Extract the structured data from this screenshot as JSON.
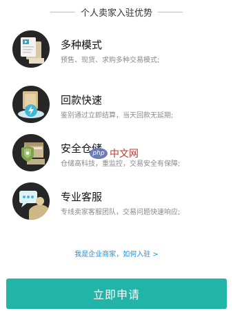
{
  "header": {
    "title": "个人卖家入驻优势"
  },
  "features": [
    {
      "title": "多种模式",
      "desc": "预售、现货、求购多种交易模式;",
      "icon": "documents-icon"
    },
    {
      "title": "回款快速",
      "desc": "鉴别通过立即结算，当天回款无延期;",
      "icon": "box-lightning-icon"
    },
    {
      "title": "安全仓储",
      "desc": "仓储高科技，重监控，交易安全有保障;",
      "icon": "warehouse-shield-icon"
    },
    {
      "title": "专业客服",
      "desc": "专线卖家客服团队，交易问题快速响应;",
      "icon": "chat-bubble-icon"
    }
  ],
  "enterprise_link": "我是企业商家，如何入驻 >",
  "apply_button": "立即申请",
  "watermark": {
    "badge": "php",
    "text": "中文网"
  }
}
